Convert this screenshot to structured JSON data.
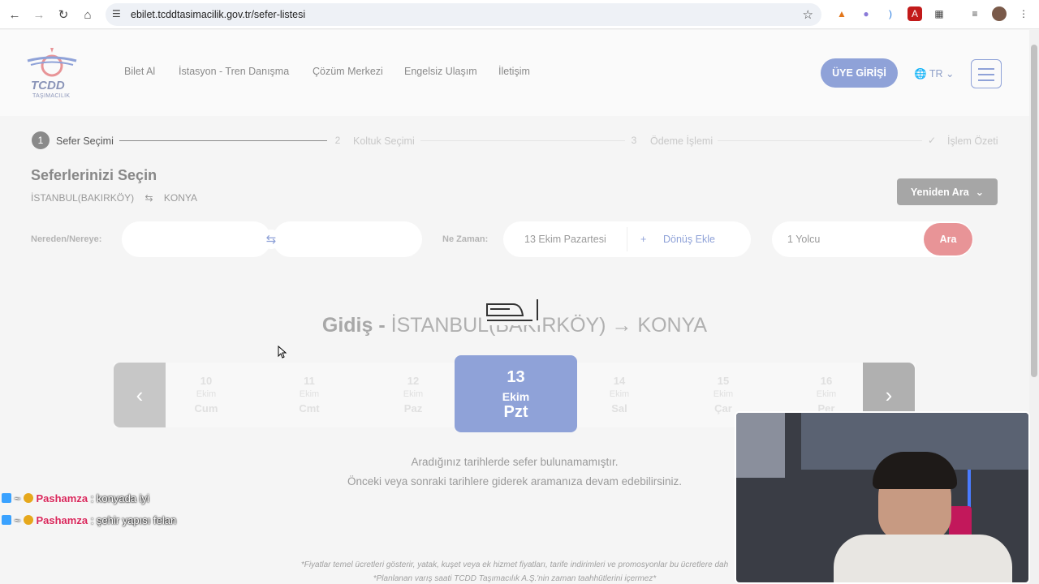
{
  "browser": {
    "url": "ebilet.tcddtasimacilik.gov.tr/sefer-listesi"
  },
  "header": {
    "logo_text": "TCDD",
    "logo_sub": "TAŞIMACILIK",
    "nav": [
      "Bilet Al",
      "İstasyon - Tren Danışma",
      "Çözüm Merkezi",
      "Engelsiz Ulaşım",
      "İletişim"
    ],
    "login_label": "ÜYE GİRİŞİ",
    "language": "TR"
  },
  "steps": [
    {
      "num": "1",
      "label": "Sefer Seçimi"
    },
    {
      "num": "2",
      "label": "Koltuk Seçimi"
    },
    {
      "num": "3",
      "label": "Ödeme İşlemi"
    },
    {
      "num": "",
      "label": "İşlem Özeti"
    }
  ],
  "search": {
    "title": "Seferlerinizi Seçin",
    "from": "İSTANBUL(BAKIRKÖY)",
    "to": "KONYA",
    "research_label": "Yeniden Ara",
    "from_to_label": "Nereden/Nereye:",
    "when_label": "Ne Zaman:",
    "date_value": "13 Ekim Pazartesi",
    "return_label": "Dönüş Ekle",
    "passenger_value": "1 Yolcu",
    "search_button": "Ara"
  },
  "results": {
    "direction_label": "Gidiş -",
    "route_text": "İSTANBUL(BAKIRKÖY)",
    "route_to": "KONYA",
    "days": [
      {
        "day": "10",
        "month": "Ekim",
        "weekday": "Cum"
      },
      {
        "day": "11",
        "month": "Ekim",
        "weekday": "Cmt"
      },
      {
        "day": "12",
        "month": "Ekim",
        "weekday": "Paz"
      },
      {
        "day": "13",
        "month": "Ekim",
        "weekday": "Pzt"
      },
      {
        "day": "14",
        "month": "Ekim",
        "weekday": "Sal"
      },
      {
        "day": "15",
        "month": "Ekim",
        "weekday": "Çar"
      },
      {
        "day": "16",
        "month": "Ekim",
        "weekday": "Per"
      }
    ],
    "no_result_1": "Aradığınız tarihlerde sefer bulunamamıştır.",
    "no_result_2": "Önceki veya sonraki tarihlere giderek aramanıza devam edebilirsiniz.",
    "footnote_1": "*Fiyatlar temel ücretleri gösterir, yatak, kuşet veya ek hizmet fiyatları, tarife indirimleri ve promosyonlar bu ücretlere dah",
    "footnote_2": "*Planlanan varış saati TCDD Taşımacılık A.Ş.'nin zaman taahhütlerini içermez*"
  },
  "chat": [
    {
      "user": "Pashamza",
      "message": ": konyada iyi"
    },
    {
      "user": "Pashamza",
      "message": ": şehir yapısı felan"
    }
  ]
}
